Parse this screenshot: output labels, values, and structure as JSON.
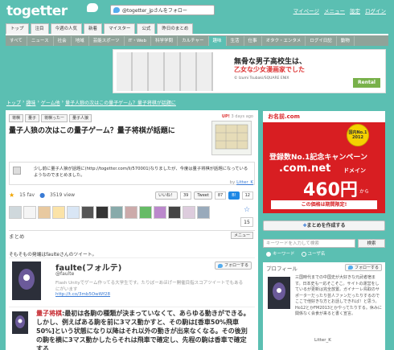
{
  "header": {
    "logo": "togetter",
    "follow_button": "@togetter_jpさんをフォロー",
    "links": [
      "マイページ",
      "メニュー",
      "設定",
      "ログイン"
    ]
  },
  "nav_primary": [
    "トップ",
    "注目",
    "今週の人気",
    "新着",
    "マイスター",
    "公式",
    "昨日のまとめ"
  ],
  "nav_secondary": [
    "すべて",
    "ニュース",
    "社会",
    "地域",
    "芸能スポーツ",
    "IT・Web",
    "科学学問",
    "カルチャー",
    "趣味",
    "生活",
    "仕事",
    "オタク・エンタメ",
    "ログイ日記",
    "動物"
  ],
  "banner": {
    "headline": "無骨な男子高校生は、",
    "subheadline": "乙女な少女漫画家でした",
    "caption": "© Izumi Tsubaki/SQUARE ENIX",
    "badge": "Rental"
  },
  "breadcrumb": [
    "トップ",
    "趣味",
    "ゲーム他",
    "量子人狼の次はこの量子ゲーム？量子将棋が話題に"
  ],
  "article": {
    "tags": [
      "将棋",
      "量子",
      "将棋ったー",
      "量子人狼"
    ],
    "updated": "3 days ago",
    "title": "量子人狼の次はこの量子ゲーム？量子将棋が話題に",
    "description": "少し前に量子人狼が話題に(http://togetter.com/li/570001)なりましたが、今度は量子将棋が話題になっているようなのでまとめました。",
    "by_label": "by",
    "author": "Litter_K",
    "favs": "15 fav",
    "views": "3519 view",
    "share": [
      {
        "label": "いいね！",
        "count": "39"
      },
      {
        "label": "Tweet",
        "count": "87"
      },
      {
        "label": "B!",
        "count": "12"
      }
    ],
    "fav_count": "15",
    "section_label": "まとめ",
    "section_menu": "メニュー",
    "intro": "そもそもの発端はfaulteさんのツイート。"
  },
  "tweet1": {
    "name": "faulte(フォルテ)",
    "handle": "@faulte",
    "bio": "Flash Unityでゲーム作ってる大学生です。たりぼーあほげー開催目指スコアツイートでもあるにがいます",
    "link": "http://t.co/3mb5OwWf28",
    "follow": "フォローする"
  },
  "tweet2": {
    "highlight": "量子将棋",
    "text": ":最初は各駒の種類が決まっていなくて、あらゆる動きができる。しかし、例えばある駒を前に3マス動かすと、その駒は[香車50%飛車50%]という状態になり以降はそれ以外の動きが出来なくなる。その後別の駒を横に3マス動かしたらそれは飛車で確定し、先程の駒は香車で確定する"
  },
  "sidebar": {
    "ad": {
      "brand": "お名前.com",
      "rank": "登録数No.1記念キャンペーン",
      "domain": ".com.net",
      "domain_suffix": "ドメイン",
      "price": "460円",
      "price_suffix": "から",
      "footer": "この価格は期間限定!",
      "badge_title": "国内No.1",
      "badge_year": "2012"
    },
    "make_button": "まとめを作成する",
    "search_placeholder": "キーワードを入力して検索",
    "search_button": "検索",
    "radio": [
      "キーワード",
      "ユーザ名"
    ],
    "profile_title": "プロフィール",
    "profile_follow": "フォローする",
    "profile_text": "三国時代までの中国史が大好きな元武者宿ます。日本史も一応そこそこ。サイトの運営をしているが更新は完全放置。ガイナーレ鳥取のサポーターだったり芸人ファンだったりするのでここで他好きな方とお話しできれば！と思う。Ho12とかFM2013とかやってたりする。休みに関係なく会食が来ると書く宣言。",
    "profile_name": "Litter_K"
  },
  "colors": {
    "background": "#5bbfb2",
    "ad_red": "#d81e22",
    "link": "#3a7bd5",
    "highlight": "#c4242b"
  }
}
